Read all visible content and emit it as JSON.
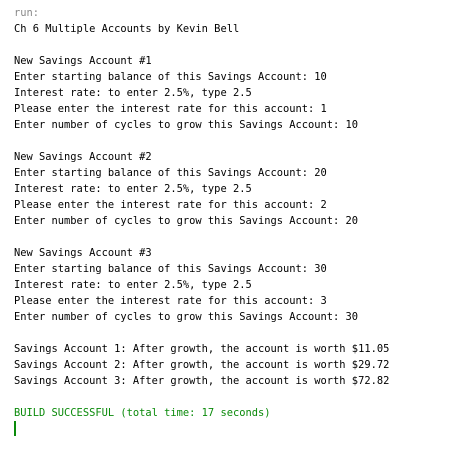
{
  "console": {
    "colors": {
      "run_label": "#888888",
      "output_text": "#000000",
      "build_status": "#0a8a0a",
      "background": "#ffffff"
    },
    "run_label": "run:",
    "title": "Ch 6 Multiple Accounts by Kevin Bell",
    "accounts": [
      {
        "header": "New Savings Account #1",
        "balance_prompt": "Enter starting balance of this Savings Account: 10",
        "rate_hint": "Interest rate: to enter 2.5%, type 2.5",
        "rate_prompt": "Please enter the interest rate for this account: 1",
        "cycles_prompt": "Enter number of cycles to grow this Savings Account: 10"
      },
      {
        "header": "New Savings Account #2",
        "balance_prompt": "Enter starting balance of this Savings Account: 20",
        "rate_hint": "Interest rate: to enter 2.5%, type 2.5",
        "rate_prompt": "Please enter the interest rate for this account: 2",
        "cycles_prompt": "Enter number of cycles to grow this Savings Account: 20"
      },
      {
        "header": "New Savings Account #3",
        "balance_prompt": "Enter starting balance of this Savings Account: 30",
        "rate_hint": "Interest rate: to enter 2.5%, type 2.5",
        "rate_prompt": "Please enter the interest rate for this account: 3",
        "cycles_prompt": "Enter number of cycles to grow this Savings Account: 30"
      }
    ],
    "results": [
      "Savings Account 1: After growth, the account is worth $11.05",
      "Savings Account 2: After growth, the account is worth $29.72",
      "Savings Account 3: After growth, the account is worth $72.82"
    ],
    "build_status": "BUILD SUCCESSFUL (total time: 17 seconds)"
  }
}
